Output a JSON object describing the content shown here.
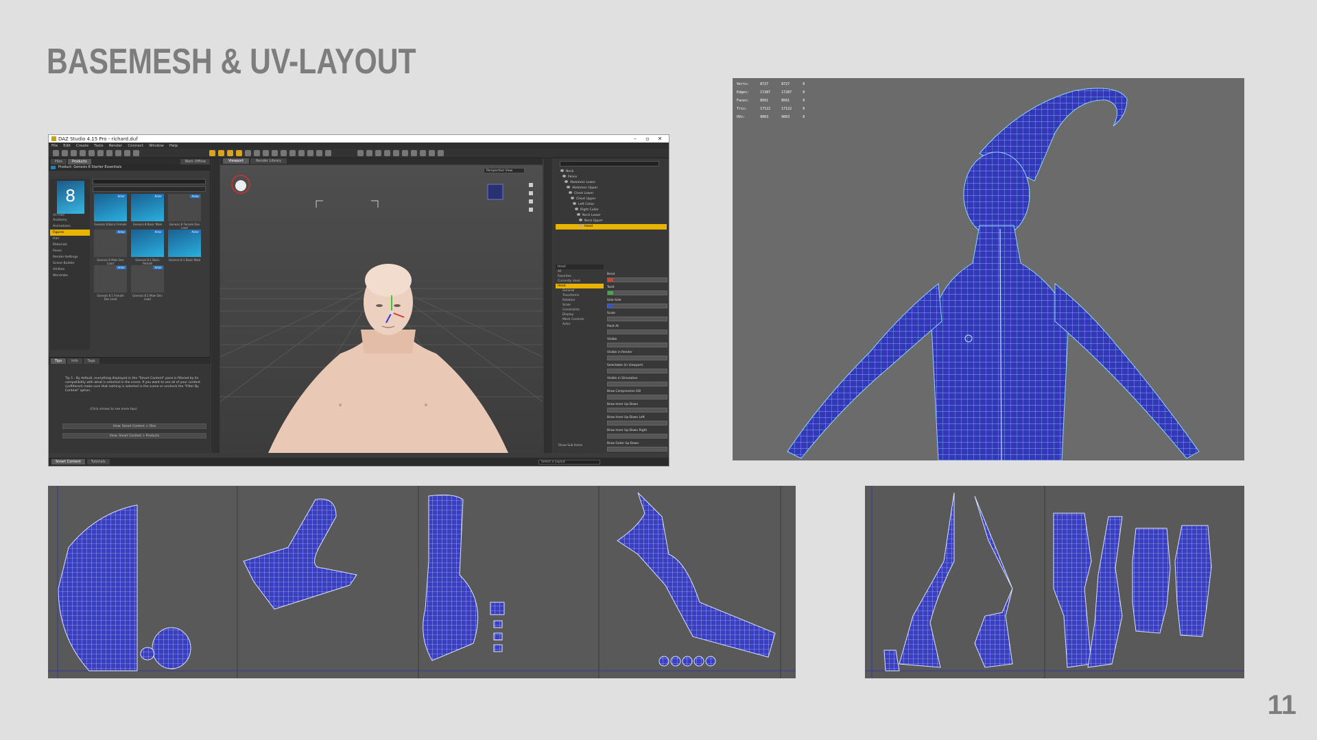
{
  "slide": {
    "title": "BASEMESH & UV-LAYOUT",
    "page_number": "11"
  },
  "daz": {
    "window_title": "DAZ Studio 4.15 Pro - richard.duf",
    "menu": [
      "File",
      "Edit",
      "Create",
      "Tools",
      "Render",
      "Connect",
      "Window",
      "Help"
    ],
    "left_tabs": [
      "Files",
      "Products"
    ],
    "left_tab_right": "Work Offline",
    "product_label": "Product: Genesis 8 Starter Essentials",
    "search_placeholder": "Enter text to filter by...",
    "sort_label": "Sort by: Name - A to Z",
    "all_files_label": "All Files",
    "categories": [
      "Anatomy",
      "Animations",
      "Figures",
      "Hair",
      "Materials",
      "Poses",
      "Render-Settings",
      "Scene Builder",
      "Utilities",
      "Wardrobe"
    ],
    "selected_category": "Figures",
    "thumbnails": [
      {
        "caption": "Genesis 8 Basic Female",
        "badge": "Actor",
        "type": "logo"
      },
      {
        "caption": "Genesis 8 Basic Male",
        "badge": "Actor",
        "type": "logo"
      },
      {
        "caption": "Genesis 8 Female Dev Load",
        "badge": "Actor",
        "type": "figure"
      },
      {
        "caption": "Genesis 8 Male Dev Load",
        "badge": "Actor",
        "type": "figure"
      },
      {
        "caption": "Genesis 8.1 Basic Female",
        "badge": "Actor",
        "type": "logo"
      },
      {
        "caption": "Genesis 8.1 Basic Male",
        "badge": "Actor",
        "type": "logo"
      },
      {
        "caption": "Genesis 8.1 Female Dev Load",
        "badge": "Actor",
        "type": "figure"
      },
      {
        "caption": "Genesis 8.1 Male Dev Load",
        "badge": "Actor",
        "type": "figure"
      }
    ],
    "tip_tabs": [
      "Tips",
      "Info",
      "Tags"
    ],
    "tip_text": "Tip 1 - By default, everything displayed in the \"Smart Content\" pane is filtered by its compatibility with what is selected in the scene. If you want to see all of your content (unfiltered) make sure that nothing is selected in the scene or uncheck the \"Filter By Context\" option.",
    "tip_click": "(Click arrows to see more tips)",
    "tip_buttons": [
      "View: Smart Content > Files",
      "View: Smart Content > Products"
    ],
    "bottom_tabs": [
      "Smart Content",
      "Tutorials"
    ],
    "layout_select": "Select a Layout",
    "viewport_tabs": [
      "Viewport",
      "Render Library"
    ],
    "perspective_label": "Perspective View",
    "scene_search_placeholder": "Enter text to filter by...",
    "scene_tree": [
      "Neck",
      "Pelvis",
      "Abdomen Lower",
      "Abdomen Upper",
      "Chest Lower",
      "Chest Upper",
      "Left Collar",
      "Right Collar",
      "Neck Lower",
      "Neck Upper",
      "Head"
    ],
    "selected_node": "Head",
    "param_header": "Head",
    "param_categories": [
      "All",
      "Favorites",
      "Currently Used",
      "Head",
      "General",
      "Transforms",
      "Rotation",
      "Scale",
      "Constraints",
      "Display",
      "Mesh Controls",
      "Actor"
    ],
    "selected_param_category": "Head",
    "params": [
      {
        "label": "Bend",
        "color": "red"
      },
      {
        "label": "Twist",
        "color": "green"
      },
      {
        "label": "Side-Side",
        "color": "blue"
      },
      {
        "label": "Scale",
        "color": "none"
      },
      {
        "label": "Point At",
        "color": "none"
      },
      {
        "label": "Visible",
        "color": "none"
      },
      {
        "label": "Visible in Render",
        "color": "none"
      },
      {
        "label": "Selectable (in Viewport)",
        "color": "none"
      },
      {
        "label": "Visible in Simulation",
        "color": "none"
      },
      {
        "label": "Brow Compression HD",
        "color": "none"
      },
      {
        "label": "Brow Inner Up-Down",
        "color": "none"
      },
      {
        "label": "Brow Inner Up-Down Left",
        "color": "none"
      },
      {
        "label": "Brow Inner Up-Down Right",
        "color": "none"
      },
      {
        "label": "Brow Outer Up-Down",
        "color": "none"
      }
    ],
    "show_sub_items_label": "Show Sub Items"
  },
  "wire_stats": [
    [
      "Verts:",
      "8727",
      "8727",
      "0"
    ],
    [
      "Edges:",
      "17287",
      "17287",
      "0"
    ],
    [
      "Faces:",
      "8561",
      "8561",
      "0"
    ],
    [
      "Tris:",
      "17122",
      "17122",
      "0"
    ],
    [
      "UVs:",
      "9063",
      "9063",
      "0"
    ]
  ],
  "colors": {
    "background": "#e0e0e0",
    "title": "#7d7d7d",
    "mesh_fill": "#3437b8",
    "mesh_wire": "#8fd4ff",
    "uv_fill": "#3a3fc0",
    "uv_wire": "#d8e4ff",
    "selection": "#e8b400"
  }
}
